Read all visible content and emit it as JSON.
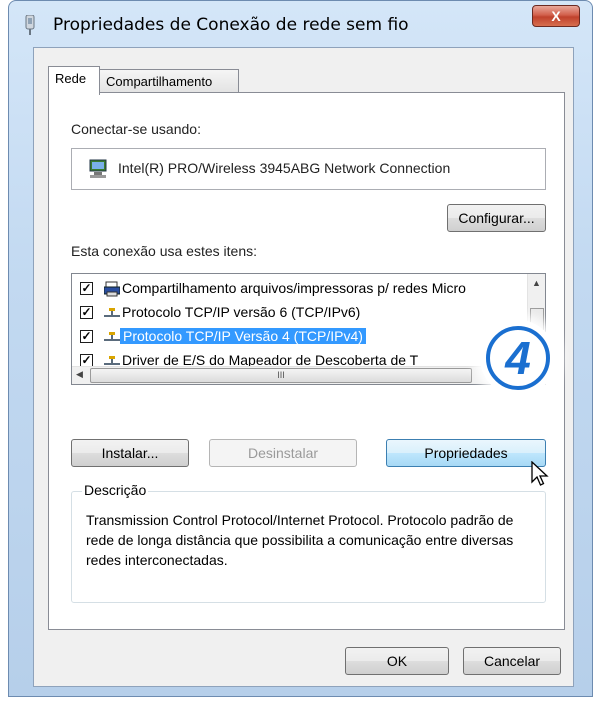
{
  "window": {
    "title": "Propriedades de Conexão de rede sem fio",
    "close_label": "X"
  },
  "tabs": [
    {
      "label": "Rede",
      "active": true
    },
    {
      "label": "Compartilhamento",
      "active": false
    }
  ],
  "connect_using": {
    "label": "Conectar-se usando:",
    "adapter": "Intel(R) PRO/Wireless 3945ABG Network Connection",
    "configure_button": "Configurar..."
  },
  "items": {
    "label": "Esta conexão usa estes itens:",
    "list": [
      {
        "label": "Compartilhamento arquivos/impressoras p/ redes Micro",
        "checked": true,
        "icon": "printer-icon"
      },
      {
        "label": "Protocolo TCP/IP versão 6 (TCP/IPv6)",
        "checked": true,
        "icon": "network-protocol-icon"
      },
      {
        "label": "Protocolo TCP/IP Versão 4 (TCP/IPv4)",
        "checked": true,
        "icon": "network-protocol-icon",
        "selected": true
      },
      {
        "label": "Driver de E/S do Mapeador de Descoberta de T",
        "checked": true,
        "icon": "network-protocol-icon"
      }
    ],
    "hscroll_grip": "III"
  },
  "buttons": {
    "install": "Instalar...",
    "uninstall": "Desinstalar",
    "properties": "Propriedades"
  },
  "description": {
    "legend": "Descrição",
    "text": "Transmission Control Protocol/Internet Protocol. Protocolo padrão de rede de longa distância que possibilita a comunicação entre diversas redes interconectadas."
  },
  "footer": {
    "ok": "OK",
    "cancel": "Cancelar"
  },
  "badge": {
    "step": "4",
    "color": "#1a6fd0"
  },
  "colors": {
    "selection": "#3399ff",
    "close": "#c0412c"
  }
}
